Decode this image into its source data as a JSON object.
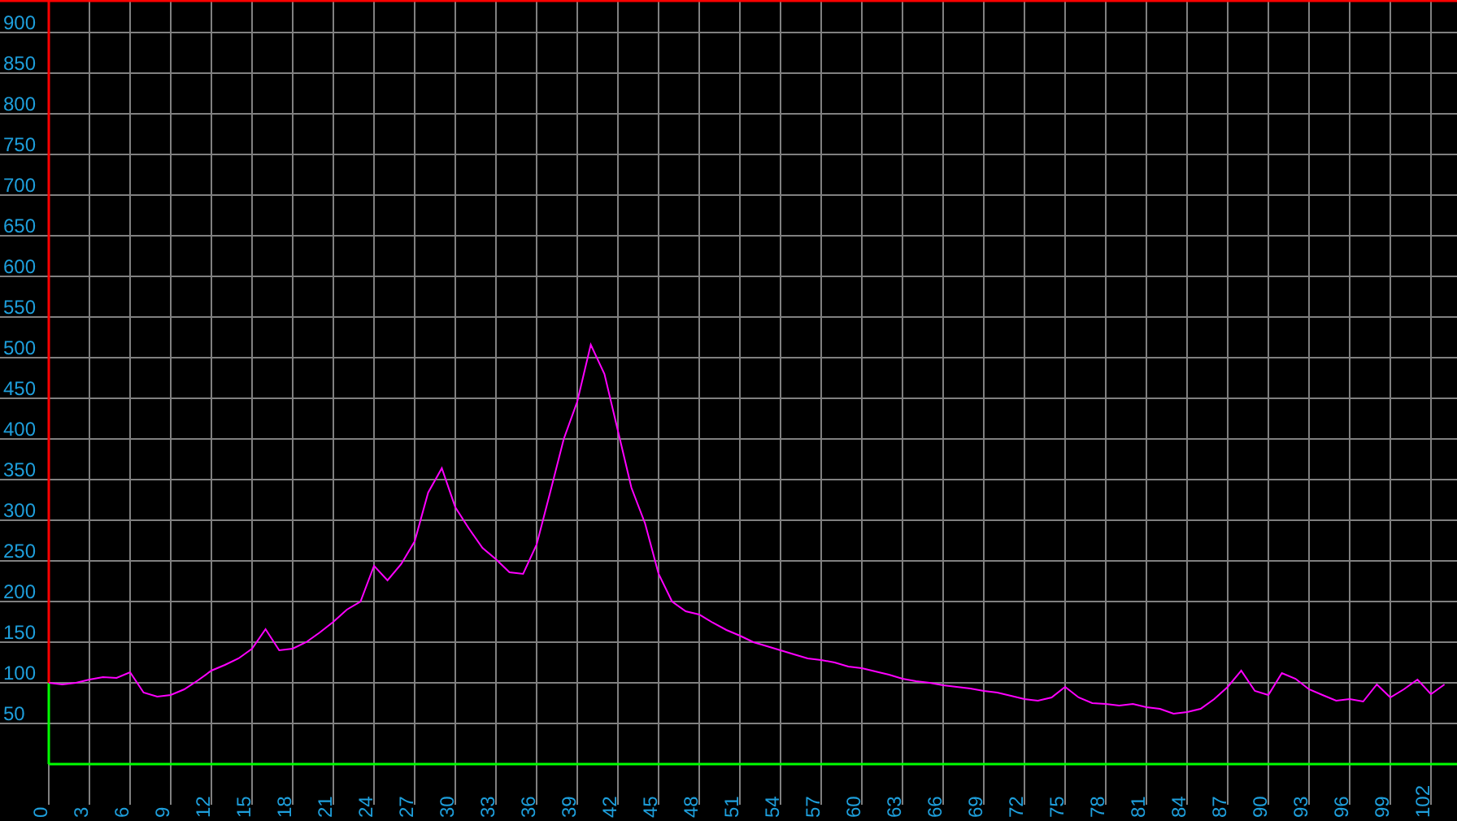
{
  "chart_data": {
    "type": "line",
    "grid": true,
    "x": [
      0,
      1,
      2,
      3,
      4,
      5,
      6,
      7,
      8,
      9,
      10,
      11,
      12,
      13,
      14,
      15,
      16,
      17,
      18,
      19,
      20,
      21,
      22,
      23,
      24,
      25,
      26,
      27,
      28,
      29,
      30,
      31,
      32,
      33,
      34,
      35,
      36,
      37,
      38,
      39,
      40,
      41,
      42,
      43,
      44,
      45,
      46,
      47,
      48,
      49,
      50,
      51,
      52,
      53,
      54,
      55,
      56,
      57,
      58,
      59,
      60,
      61,
      62,
      63,
      64,
      65,
      66,
      67,
      68,
      69,
      70,
      71,
      72,
      73,
      74,
      75,
      76,
      77,
      78,
      79,
      80,
      81,
      82,
      83,
      84,
      85,
      86,
      87,
      88,
      89,
      90,
      91,
      92,
      93,
      94,
      95,
      96,
      97,
      98,
      99,
      100,
      101,
      102,
      103
    ],
    "values": [
      100,
      98,
      100,
      104,
      107,
      106,
      113,
      88,
      83,
      85,
      92,
      103,
      115,
      122,
      130,
      142,
      166,
      140,
      142,
      150,
      162,
      175,
      190,
      200,
      244,
      226,
      246,
      274,
      334,
      364,
      316,
      290,
      266,
      252,
      236,
      234,
      270,
      334,
      400,
      446,
      516,
      480,
      410,
      340,
      296,
      234,
      200,
      188,
      184,
      174,
      165,
      158,
      150,
      145,
      140,
      135,
      130,
      128,
      125,
      120,
      118,
      114,
      110,
      105,
      102,
      100,
      97,
      95,
      93,
      90,
      88,
      84,
      80,
      78,
      82,
      95,
      82,
      75,
      74,
      72,
      74,
      70,
      68,
      62,
      64,
      68,
      80,
      95,
      115,
      90,
      85,
      112,
      105,
      92,
      85,
      78,
      80,
      77,
      98,
      82,
      92,
      104,
      86,
      98
    ],
    "xlim": [
      0,
      103.92
    ],
    "ylim": [
      0,
      940
    ],
    "xticks": [
      0,
      3,
      6,
      9,
      12,
      15,
      18,
      21,
      24,
      27,
      30,
      33,
      36,
      39,
      42,
      45,
      48,
      51,
      54,
      57,
      60,
      63,
      66,
      69,
      72,
      75,
      78,
      81,
      84,
      87,
      90,
      93,
      96,
      99,
      102
    ],
    "yticks": [
      50,
      100,
      150,
      200,
      250,
      300,
      350,
      400,
      450,
      500,
      550,
      600,
      650,
      700,
      750,
      800,
      850,
      900
    ]
  }
}
